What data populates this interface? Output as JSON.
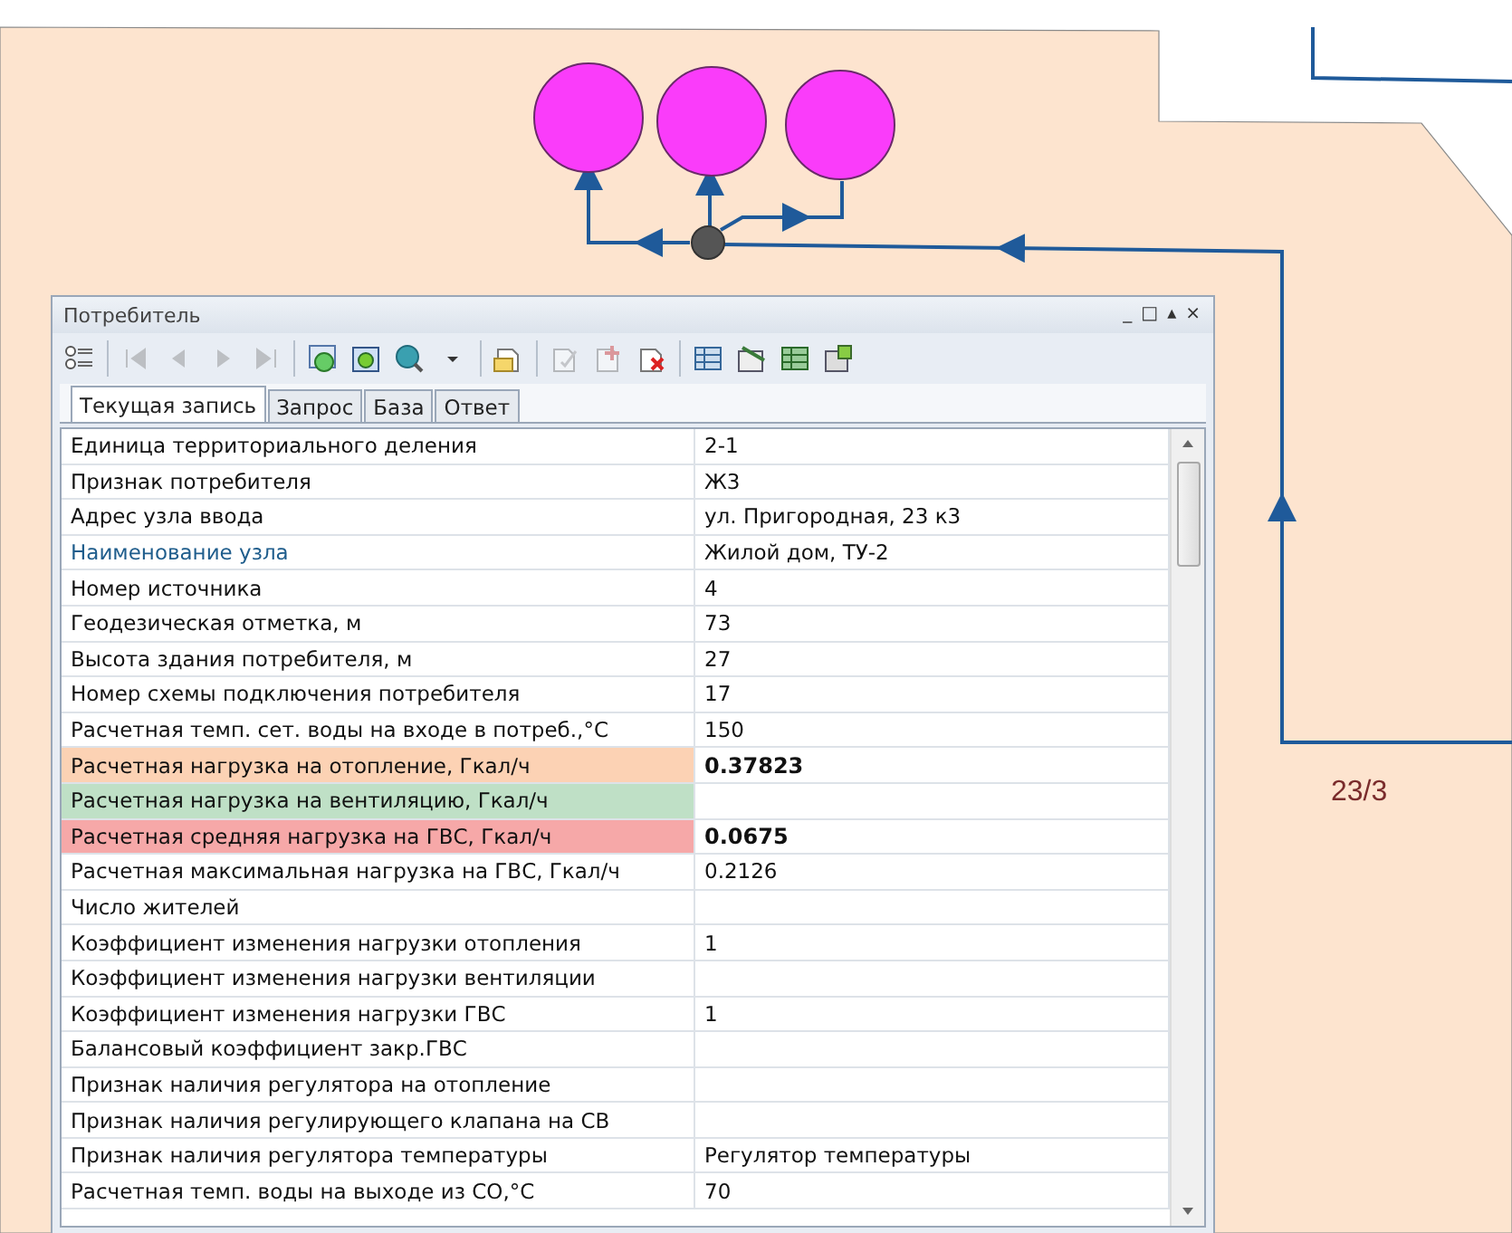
{
  "map": {
    "label": "23/3"
  },
  "window": {
    "title": "Потребитель",
    "controls": [
      "_",
      "□",
      "▴",
      "×"
    ]
  },
  "toolbar": {
    "navigation": {
      "disabled": true
    }
  },
  "tabs": [
    {
      "label": "Текущая запись",
      "selected": true
    },
    {
      "label": "Запрос",
      "selected": false
    },
    {
      "label": "База",
      "selected": false
    },
    {
      "label": "Ответ",
      "selected": false
    }
  ],
  "rows": [
    {
      "label": "Единица территориального деления",
      "value": "2-1",
      "linked": false,
      "bold": false
    },
    {
      "label": "Признак потребителя",
      "value": "Ж3",
      "linked": false,
      "bold": false
    },
    {
      "label": "Адрес узла ввода",
      "value": "ул. Пригородная, 23 к3",
      "linked": false,
      "bold": false
    },
    {
      "label": "Наименование узла",
      "value": "Жилой дом, ТУ-2",
      "linked": true,
      "bold": false
    },
    {
      "label": "Номер источника",
      "value": "4",
      "linked": false,
      "bold": false
    },
    {
      "label": "Геодезическая отметка, м",
      "value": "73",
      "linked": false,
      "bold": false
    },
    {
      "label": "Высота здания потребителя, м",
      "value": "27",
      "linked": false,
      "bold": false
    },
    {
      "label": "Номер схемы подключения потребителя",
      "value": "17",
      "linked": false,
      "bold": false
    },
    {
      "label": "Расчетная темп. сет. воды на входе в потреб.,°C",
      "value": "150",
      "linked": false,
      "bold": false
    },
    {
      "label": "Расчетная нагрузка на отопление, Гкал/ч",
      "value": "0.37823",
      "linked": false,
      "bold": true,
      "color": "#fcd2b4"
    },
    {
      "label": "Расчетная нагрузка на вентиляцию, Гкал/ч",
      "linked": false,
      "color": "#bfe0c6"
    },
    {
      "label": "Расчетная средняя нагрузка на ГВС, Гкал/ч",
      "value": "0.0675",
      "linked": false,
      "bold": true,
      "color": "#f6a8a8"
    },
    {
      "label": "Расчетная максимальная нагрузка на ГВС, Гкал/ч",
      "value": "0.2126",
      "linked": false,
      "bold": false
    },
    {
      "label": "Число жителей",
      "linked": false
    },
    {
      "label": "Коэффициент изменения нагрузки отопления",
      "value": "1",
      "linked": false,
      "bold": false
    },
    {
      "label": "Коэффициент изменения нагрузки вентиляции",
      "linked": false
    },
    {
      "label": "Коэффициент изменения нагрузки ГВС",
      "value": "1",
      "linked": false,
      "bold": false
    },
    {
      "label": "Балансовый коэффициент закр.ГВС",
      "linked": false
    },
    {
      "label": "Признак наличия регулятора на отопление",
      "linked": false
    },
    {
      "label": "Признак наличия регулирующего клапана на СВ",
      "linked": false
    },
    {
      "label": "Признак наличия регулятора температуры",
      "value": "Регулятор температуры",
      "linked": false,
      "bold": false
    },
    {
      "label": "Расчетная темп. воды на выходе из СО,°C",
      "value": "70",
      "linked": false,
      "bold": false
    }
  ]
}
